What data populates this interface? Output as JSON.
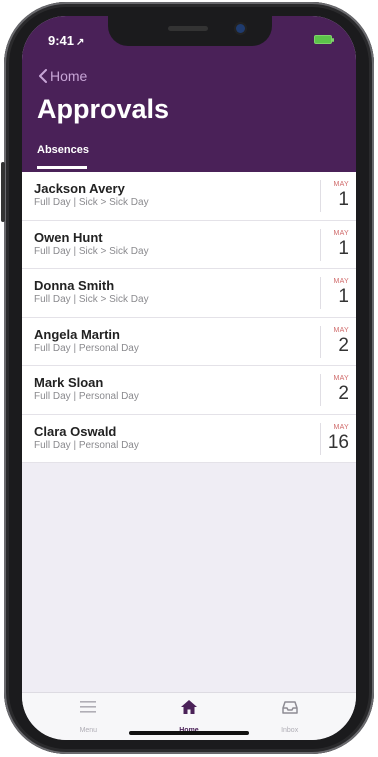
{
  "status_bar": {
    "time": "9:41",
    "location_glyph": "↗"
  },
  "nav": {
    "back_label": "Home",
    "title": "Approvals",
    "tab_label": "Absences"
  },
  "absences": [
    {
      "name": "Jackson Avery",
      "detail": "Full Day | Sick > Sick Day",
      "month": "MAY",
      "day": "1"
    },
    {
      "name": "Owen Hunt",
      "detail": "Full Day | Sick > Sick Day",
      "month": "MAY",
      "day": "1"
    },
    {
      "name": "Donna Smith",
      "detail": "Full Day | Sick > Sick Day",
      "month": "MAY",
      "day": "1"
    },
    {
      "name": "Angela Martin",
      "detail": "Full Day | Personal Day",
      "month": "MAY",
      "day": "2"
    },
    {
      "name": "Mark Sloan",
      "detail": "Full Day | Personal Day",
      "month": "MAY",
      "day": "2"
    },
    {
      "name": "Clara Oswald",
      "detail": "Full Day | Personal Day",
      "month": "MAY",
      "day": "16"
    }
  ],
  "tabbar": {
    "items": [
      {
        "label": "Menu",
        "icon": "menu-icon",
        "active": false
      },
      {
        "label": "Home",
        "icon": "home-icon",
        "active": true
      },
      {
        "label": "Inbox",
        "icon": "inbox-icon",
        "active": false
      }
    ]
  },
  "colors": {
    "header_bg": "#4a2158",
    "back_link": "#c7a5d6",
    "month_label": "#d06a6a",
    "active_tab": "#4a2158",
    "inactive_tab": "#b0aeb6"
  }
}
